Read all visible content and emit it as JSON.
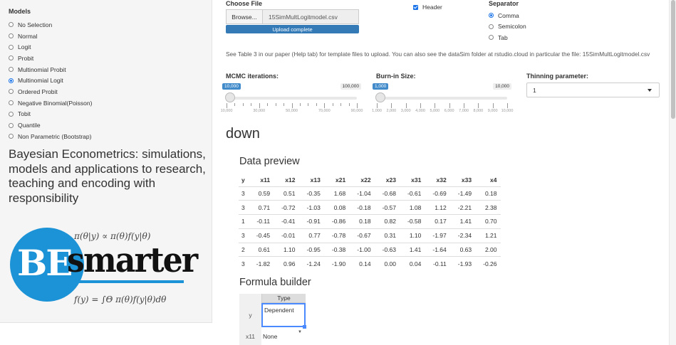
{
  "sidebar": {
    "models_label": "Models",
    "models": [
      {
        "label": "No Selection",
        "selected": false
      },
      {
        "label": "Normal",
        "selected": false
      },
      {
        "label": "Logit",
        "selected": false
      },
      {
        "label": "Probit",
        "selected": false
      },
      {
        "label": "Multinomial Probit",
        "selected": false
      },
      {
        "label": "Multinomial Logit",
        "selected": true
      },
      {
        "label": "Ordered Probit",
        "selected": false
      },
      {
        "label": "Negative Binomial(Poisson)",
        "selected": false
      },
      {
        "label": "Tobit",
        "selected": false
      },
      {
        "label": "Quantile",
        "selected": false
      },
      {
        "label": "Non Parametric (Bootstrap)",
        "selected": false
      }
    ],
    "app_title": "Bayesian Econometrics: simulations, models and applications to research, teaching and encoding with responsibility",
    "logo": {
      "be": "BE",
      "smarter": "smarter",
      "eq1": "π(θ|y) ∝ π(θ)f(y|θ)",
      "eq2": "f(y) = ∫Θ π(θ)f(y|θ)dθ",
      "color": "#1c93d6"
    }
  },
  "file_upload": {
    "label": "Choose File",
    "browse_label": "Browse...",
    "file_name": "15SimMultLogitmodel.csv",
    "progress_text": "Upload complete",
    "progress": 1.0
  },
  "header_option": {
    "label": "Header",
    "checked": true
  },
  "separator": {
    "label": "Separator",
    "options": [
      {
        "label": "Comma",
        "selected": true
      },
      {
        "label": "Semicolon",
        "selected": false
      },
      {
        "label": "Tab",
        "selected": false
      }
    ]
  },
  "info_text": "See Table 3 in our paper (Help tab) for template files to upload. You can also see the dataSim folder at rstudio.cloud in particular the file: 15SimMultLogitmodel.csv",
  "mcmc": {
    "label": "MCMC iterations:",
    "value": "10,000",
    "max": "100,000",
    "ticks": [
      "10,000",
      "30,000",
      "50,000",
      "70,000",
      "90,000"
    ]
  },
  "burnin": {
    "label": "Burn-in Size:",
    "value": "1,000",
    "max": "10,000",
    "ticks": [
      "1,000",
      "2,000",
      "3,000",
      "4,000",
      "5,000",
      "6,000",
      "7,000",
      "8,000",
      "9,000",
      "10,000"
    ]
  },
  "thinning": {
    "label": "Thinning parameter:",
    "value": "1"
  },
  "section_title": "down",
  "data_preview": {
    "title": "Data preview",
    "columns": [
      "y",
      "x11",
      "x12",
      "x13",
      "x21",
      "x22",
      "x23",
      "x31",
      "x32",
      "x33",
      "x4"
    ],
    "rows": [
      [
        "3",
        "0.59",
        "0.51",
        "-0.35",
        "1.68",
        "-1.04",
        "-0.68",
        "-0.61",
        "-0.69",
        "-1.49",
        "0.18"
      ],
      [
        "3",
        "0.71",
        "-0.72",
        "-1.03",
        "0.08",
        "-0.18",
        "-0.57",
        "1.08",
        "1.12",
        "-2.21",
        "2.38"
      ],
      [
        "1",
        "-0.11",
        "-0.41",
        "-0.91",
        "-0.86",
        "0.18",
        "0.82",
        "-0.58",
        "0.17",
        "1.41",
        "0.70"
      ],
      [
        "3",
        "-0.45",
        "-0.01",
        "0.77",
        "-0.78",
        "-0.67",
        "0.31",
        "1.10",
        "-1.97",
        "-2.34",
        "1.21"
      ],
      [
        "2",
        "0.61",
        "1.10",
        "-0.95",
        "-0.38",
        "-1.00",
        "-0.63",
        "1.41",
        "-1.64",
        "0.63",
        "2.00"
      ],
      [
        "3",
        "-1.82",
        "0.96",
        "-1.24",
        "-1.90",
        "0.14",
        "0.00",
        "0.04",
        "-0.11",
        "-1.93",
        "-0.26"
      ]
    ]
  },
  "formula_builder": {
    "title": "Formula builder",
    "type_header": "Type",
    "rows": [
      {
        "var": "y",
        "type": "Dependent"
      },
      {
        "var": "x11",
        "type": "None"
      }
    ]
  }
}
